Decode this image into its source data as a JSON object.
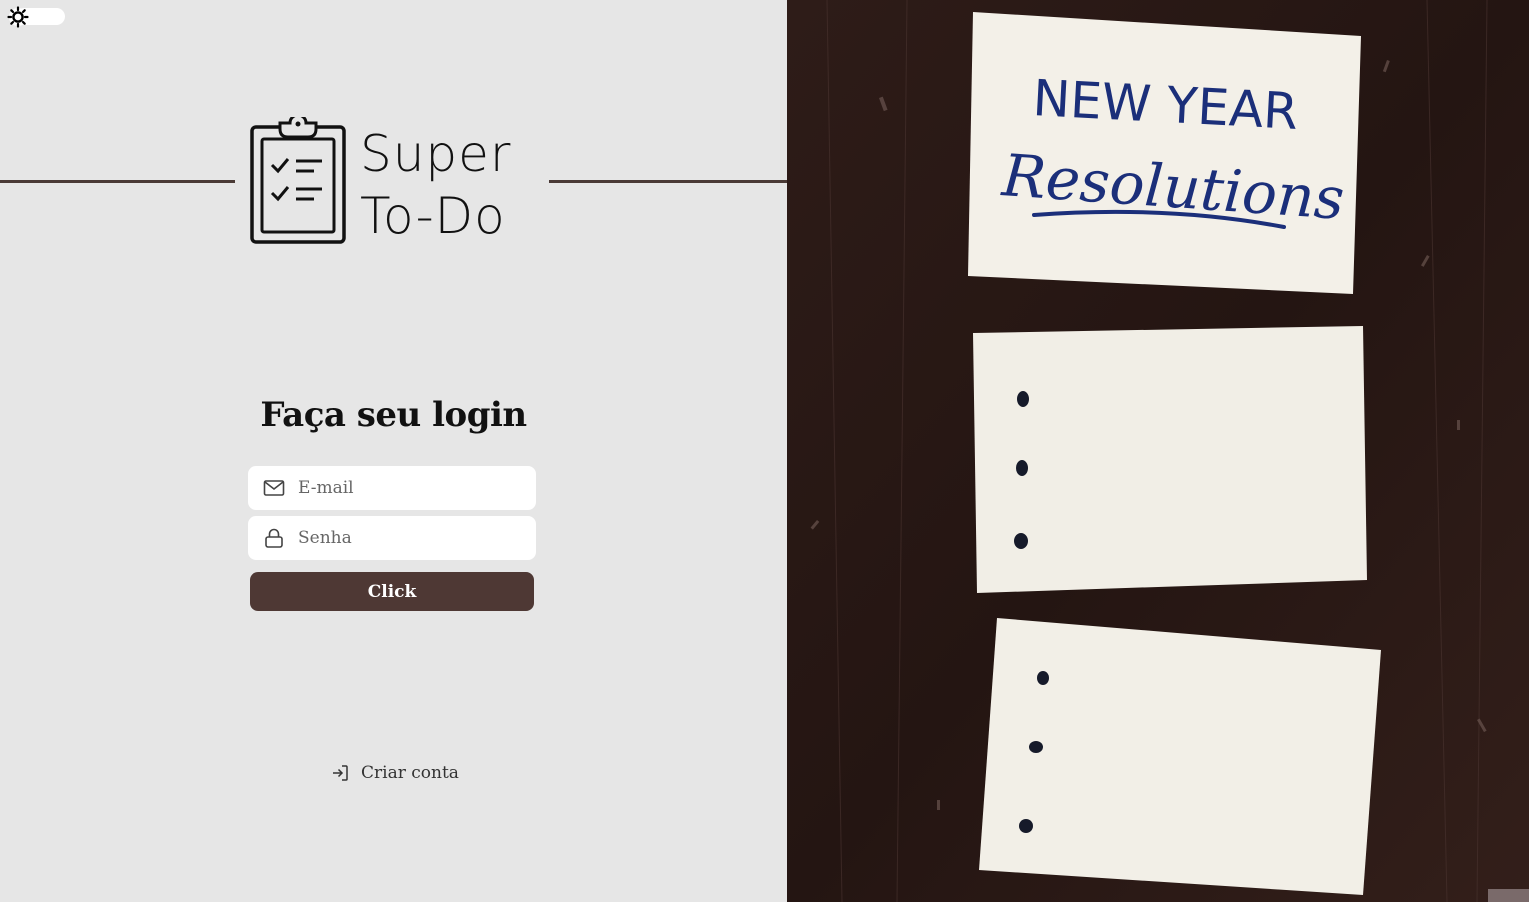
{
  "brand": {
    "line1": "Super",
    "line2": "To-Do"
  },
  "login": {
    "title": "Faça seu login",
    "email_placeholder": "E-mail",
    "password_placeholder": "Senha",
    "submit_label": "Click",
    "create_account_label": "Criar conta"
  },
  "theme_toggle": {
    "icon": "sun-icon"
  },
  "illustration": {
    "heading_line1": "NEW YEAR",
    "heading_line2": "Resolutions"
  },
  "colors": {
    "background": "#e6e6e6",
    "accent": "#4e3834",
    "ink": "#1b2f7a",
    "wood": "#2a1a17"
  }
}
